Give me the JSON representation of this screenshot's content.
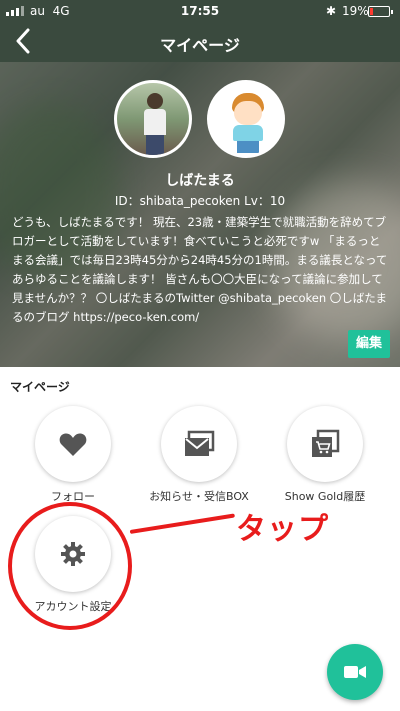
{
  "status_bar": {
    "carrier": "au",
    "network": "4G",
    "time": "17:55",
    "bluetooth_icon": "bluetooth-icon",
    "battery_percent": "19%",
    "battery_level": 0.19,
    "battery_color": "#ff3b30"
  },
  "nav": {
    "back_label": "<",
    "title": "マイページ"
  },
  "profile": {
    "name": "しばたまる",
    "id_line": "ID：shibata_pecoken Lv：10",
    "bio": "どうも、しばたまるです！ 現在、23歳・建築学生で就職活動を辞めてブロガーとして活動をしています！食べていこうと必死ですw 「まるっとまる会議」では毎日23時45分から24時45分の1時間。まる議長となってあらゆることを議論します！ 皆さんも〇〇大臣になって議論に参加して見ませんか？？ 〇しばたまるのTwitter @shibata_pecoken 〇しばたまるのブログ https://peco-ken.com/",
    "edit_label": "編集"
  },
  "mypage": {
    "section_label": "マイページ",
    "items": [
      {
        "label": "フォロー",
        "icon": "heart-icon"
      },
      {
        "label": "お知らせ・受信BOX",
        "icon": "inbox-icon"
      },
      {
        "label": "Show Gold履歴",
        "icon": "shopping-cart-icon"
      },
      {
        "label": "アカウント設定",
        "icon": "gear-icon"
      }
    ]
  },
  "fab": {
    "icon": "video-camera-icon"
  },
  "annotation": {
    "text": "タップ",
    "color": "#e81c1c"
  },
  "colors": {
    "header_bg": "#3a4a3e",
    "accent": "#20c19a",
    "icon_gray": "#555555"
  }
}
